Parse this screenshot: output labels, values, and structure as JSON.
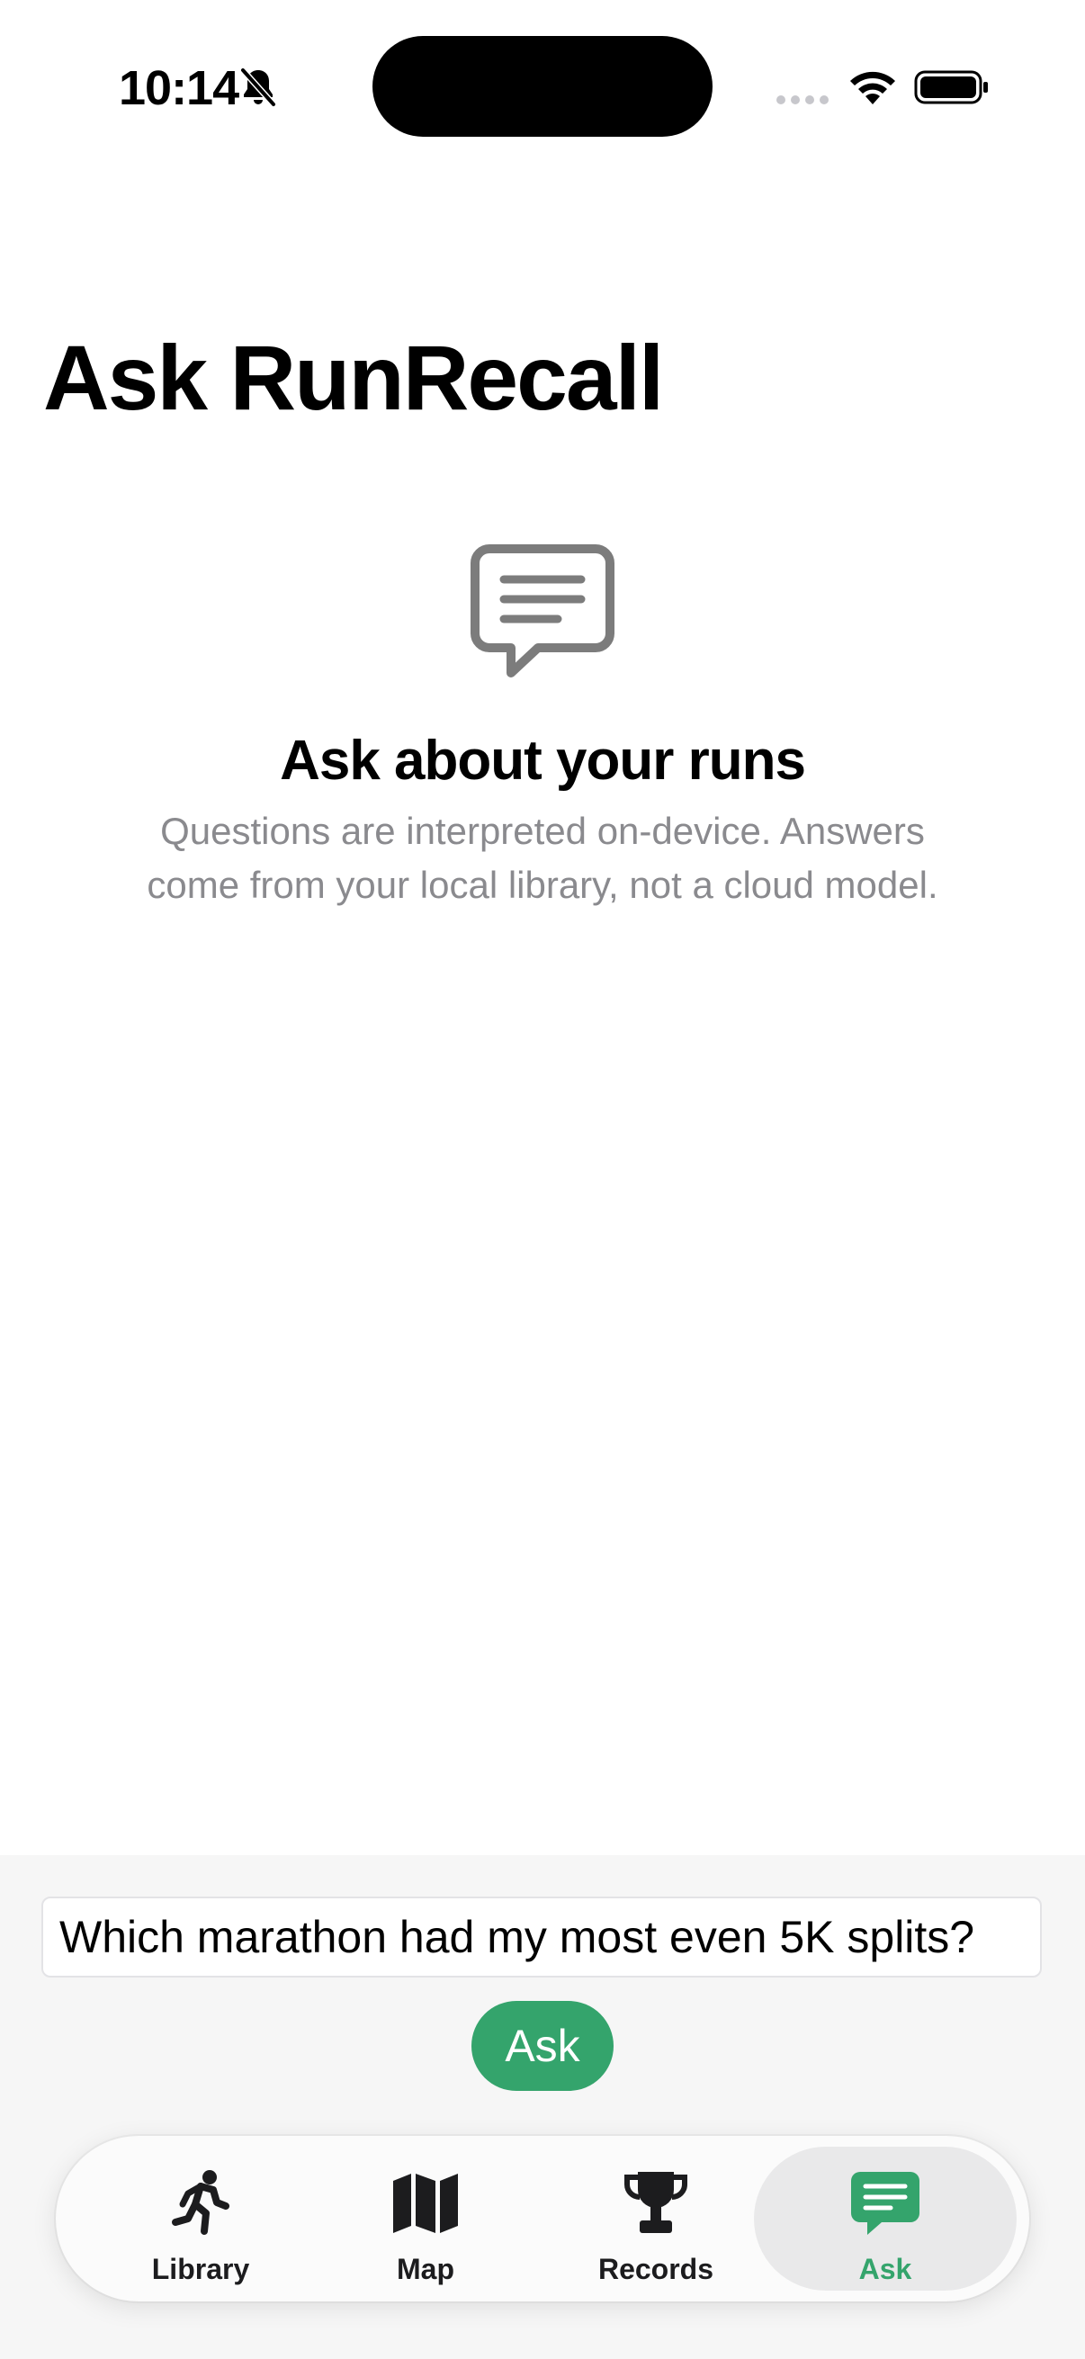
{
  "status_bar": {
    "time": "10:14",
    "icons": [
      "bell-slash-icon",
      "cellular-icon",
      "wifi-icon",
      "battery-icon"
    ]
  },
  "page": {
    "title": "Ask RunRecall"
  },
  "empty_state": {
    "icon": "chat-bubble-icon",
    "title": "Ask about your runs",
    "body": "Questions are interpreted on-device. Answers come from your local library, not a cloud model."
  },
  "composer": {
    "question_value": "Which marathon had my most even 5K splits?",
    "ask_label": "Ask"
  },
  "tab_bar": {
    "tabs": [
      {
        "label": "Library",
        "icon": "runner-icon",
        "selected": false
      },
      {
        "label": "Map",
        "icon": "map-icon",
        "selected": false
      },
      {
        "label": "Records",
        "icon": "trophy-icon",
        "selected": false
      },
      {
        "label": "Ask",
        "icon": "chat-bubble-icon",
        "selected": true
      }
    ]
  },
  "colors": {
    "accent": "#34a46c",
    "secondary_text": "#8a8a8e",
    "panel_background": "#f6f6f6"
  }
}
